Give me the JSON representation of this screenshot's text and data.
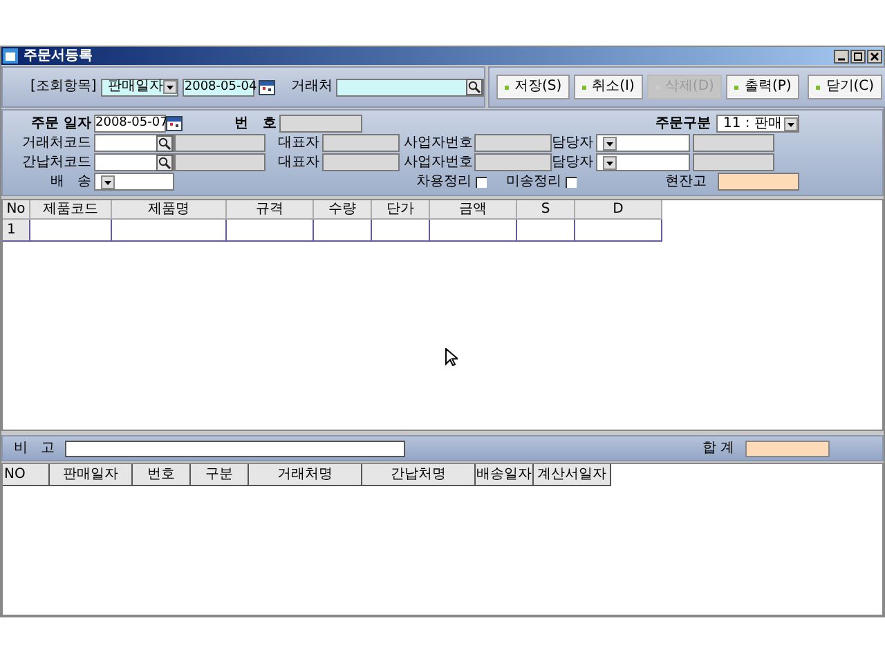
{
  "window": {
    "title": "주문서등록"
  },
  "search": {
    "label": "[조회항목]",
    "field": "판매일자",
    "date": "2008-05-04",
    "partner_label": "거래처"
  },
  "buttons": [
    {
      "label": "저장(S)",
      "disabled": false
    },
    {
      "label": "취소(I)",
      "disabled": false
    },
    {
      "label": "삭제(D)",
      "disabled": true
    },
    {
      "label": "출력(P)",
      "disabled": false
    }
  ],
  "close_button": {
    "label": "닫기(C)"
  },
  "form": {
    "order_date_label": "주문 일자",
    "order_date": "2008-05-07",
    "number_label": "번   호",
    "order_type_label": "주문구분",
    "order_type": "11 : 판매",
    "parties": [
      {
        "code_label": "거래처코드",
        "rep_label": "대표자",
        "biz_label": "사업자번호",
        "manager_label": "담당자"
      },
      {
        "code_label": "간납처코드",
        "rep_label": "대표자",
        "biz_label": "사업자번호",
        "manager_label": "담당자"
      }
    ],
    "delivery_label": "배   송",
    "checks": [
      {
        "label": "차용정리",
        "checked": false
      },
      {
        "label": "미송정리",
        "checked": false
      }
    ],
    "stock_label": "현잔고"
  },
  "grid": {
    "columns": [
      "No",
      "제품코드",
      "제품명",
      "규격",
      "수량",
      "단가",
      "금액",
      "S",
      "D"
    ],
    "rows": [
      [
        "1",
        "",
        "",
        "",
        "",
        "",
        "",
        "",
        ""
      ]
    ]
  },
  "remark": {
    "label": "비   고",
    "total_label": "합 계"
  },
  "list": {
    "columns": [
      "NO",
      "판매일자",
      "번호",
      "구분",
      "거래처명",
      "간납처명",
      "배송일자",
      "계산서일자"
    ]
  }
}
